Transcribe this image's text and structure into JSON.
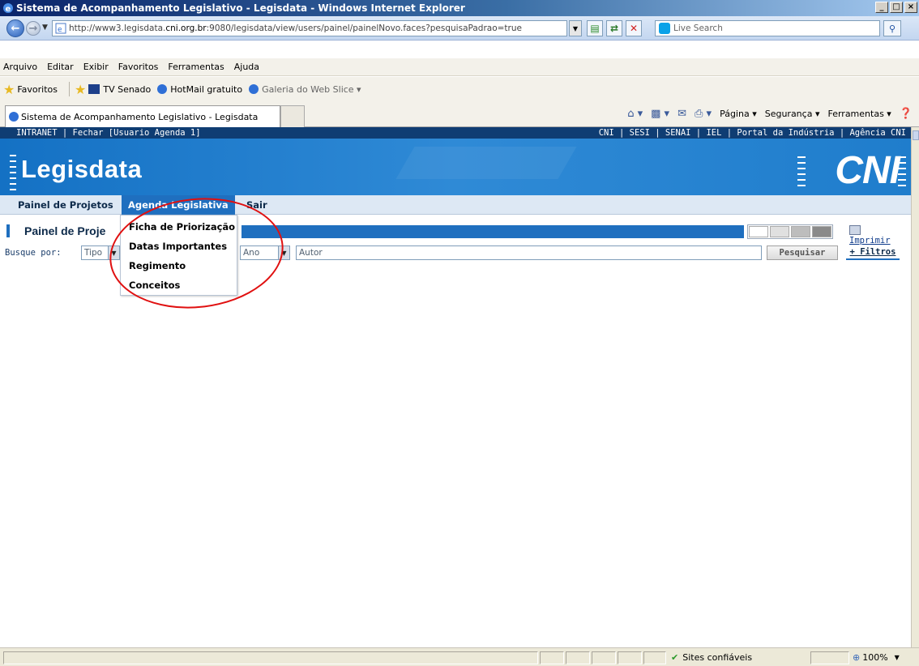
{
  "window": {
    "title": "Sistema de Acompanhamento Legislativo - Legisdata - Windows Internet Explorer",
    "buttons": [
      "_",
      "□",
      "×"
    ]
  },
  "address": {
    "url_prefix": "http://www3.legisdata.",
    "url_domain": "cni.org.br",
    "url_suffix": ":9080/legisdata/view/users/painel/painelNovo.faces?pesquisaPadrao=true",
    "search_placeholder": "Live Search"
  },
  "menubar": [
    "Arquivo",
    "Editar",
    "Exibir",
    "Favoritos",
    "Ferramentas",
    "Ajuda"
  ],
  "favorites": {
    "label": "Favoritos",
    "items": [
      "TV Senado",
      "HotMail gratuito",
      "Galeria do Web Slice ▾"
    ]
  },
  "tab": {
    "title": "Sistema de Acompanhamento Legislativo - Legisdata"
  },
  "commandbar": [
    "Página ▾",
    "Segurança ▾",
    "Ferramentas ▾"
  ],
  "intranet": {
    "left": "INTRANET | Fechar  [Usuario Agenda 1]",
    "right": "CNI | SESI | SENAI | IEL | Portal da Indústria | Agência CNI"
  },
  "banner": {
    "logo": "Legisdata",
    "brand": "CNI"
  },
  "appmenu": {
    "items": [
      "Painel de Projetos",
      "Agenda Legislativa",
      "Sair"
    ]
  },
  "dropdown": {
    "items": [
      "Ficha de Priorização",
      "Datas Importantes",
      "Regimento",
      "Conceitos"
    ]
  },
  "panel": {
    "title": "Painel de Proje",
    "print_label": "Imprimir"
  },
  "search": {
    "label": "Busque por:",
    "tipo_placeholder": "Tipo",
    "ano_placeholder": "Ano",
    "autor_placeholder": "Autor",
    "button": "Pesquisar",
    "filters": "+ Filtros"
  },
  "statusbar": {
    "zone": "Sites confiáveis",
    "zoom": "100%"
  },
  "colors": {
    "banner_blue": "#1f6fbf",
    "header_dark": "#0f3d73",
    "annotation_red": "#e01010"
  }
}
